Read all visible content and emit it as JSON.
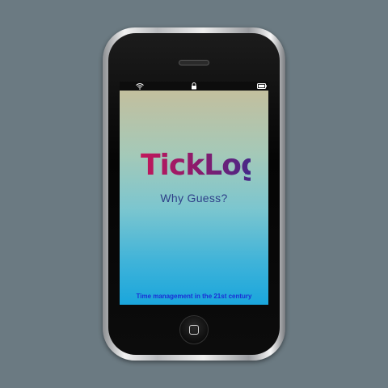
{
  "app": {
    "logo_text": "TickLog",
    "tagline": "Why Guess?",
    "footer": "Time management in the 21st century"
  },
  "status_bar": {
    "icons": [
      "wifi-icon",
      "lock-icon",
      "battery-icon"
    ]
  },
  "colors": {
    "background": "#6b7a82",
    "logo_gradient_start": "#c2185b",
    "logo_gradient_end": "#3b2a8c",
    "tagline": "#2e3f88",
    "footer": "#1a2fd6",
    "screen_top": "#c3bf9e",
    "screen_bottom": "#1aa6dc"
  }
}
